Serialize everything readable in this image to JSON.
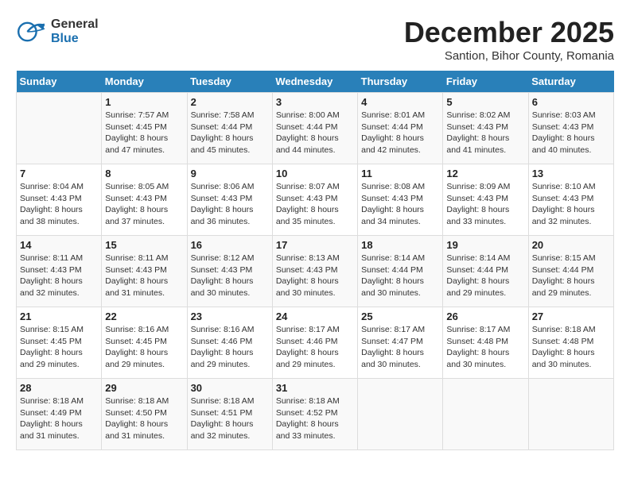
{
  "header": {
    "logo_general": "General",
    "logo_blue": "Blue",
    "month_title": "December 2025",
    "subtitle": "Santion, Bihor County, Romania"
  },
  "days_of_week": [
    "Sunday",
    "Monday",
    "Tuesday",
    "Wednesday",
    "Thursday",
    "Friday",
    "Saturday"
  ],
  "weeks": [
    [
      {
        "day": "",
        "sunrise": "",
        "sunset": "",
        "daylight": ""
      },
      {
        "day": "1",
        "sunrise": "Sunrise: 7:57 AM",
        "sunset": "Sunset: 4:45 PM",
        "daylight": "Daylight: 8 hours and 47 minutes."
      },
      {
        "day": "2",
        "sunrise": "Sunrise: 7:58 AM",
        "sunset": "Sunset: 4:44 PM",
        "daylight": "Daylight: 8 hours and 45 minutes."
      },
      {
        "day": "3",
        "sunrise": "Sunrise: 8:00 AM",
        "sunset": "Sunset: 4:44 PM",
        "daylight": "Daylight: 8 hours and 44 minutes."
      },
      {
        "day": "4",
        "sunrise": "Sunrise: 8:01 AM",
        "sunset": "Sunset: 4:44 PM",
        "daylight": "Daylight: 8 hours and 42 minutes."
      },
      {
        "day": "5",
        "sunrise": "Sunrise: 8:02 AM",
        "sunset": "Sunset: 4:43 PM",
        "daylight": "Daylight: 8 hours and 41 minutes."
      },
      {
        "day": "6",
        "sunrise": "Sunrise: 8:03 AM",
        "sunset": "Sunset: 4:43 PM",
        "daylight": "Daylight: 8 hours and 40 minutes."
      }
    ],
    [
      {
        "day": "7",
        "sunrise": "Sunrise: 8:04 AM",
        "sunset": "Sunset: 4:43 PM",
        "daylight": "Daylight: 8 hours and 38 minutes."
      },
      {
        "day": "8",
        "sunrise": "Sunrise: 8:05 AM",
        "sunset": "Sunset: 4:43 PM",
        "daylight": "Daylight: 8 hours and 37 minutes."
      },
      {
        "day": "9",
        "sunrise": "Sunrise: 8:06 AM",
        "sunset": "Sunset: 4:43 PM",
        "daylight": "Daylight: 8 hours and 36 minutes."
      },
      {
        "day": "10",
        "sunrise": "Sunrise: 8:07 AM",
        "sunset": "Sunset: 4:43 PM",
        "daylight": "Daylight: 8 hours and 35 minutes."
      },
      {
        "day": "11",
        "sunrise": "Sunrise: 8:08 AM",
        "sunset": "Sunset: 4:43 PM",
        "daylight": "Daylight: 8 hours and 34 minutes."
      },
      {
        "day": "12",
        "sunrise": "Sunrise: 8:09 AM",
        "sunset": "Sunset: 4:43 PM",
        "daylight": "Daylight: 8 hours and 33 minutes."
      },
      {
        "day": "13",
        "sunrise": "Sunrise: 8:10 AM",
        "sunset": "Sunset: 4:43 PM",
        "daylight": "Daylight: 8 hours and 32 minutes."
      }
    ],
    [
      {
        "day": "14",
        "sunrise": "Sunrise: 8:11 AM",
        "sunset": "Sunset: 4:43 PM",
        "daylight": "Daylight: 8 hours and 32 minutes."
      },
      {
        "day": "15",
        "sunrise": "Sunrise: 8:11 AM",
        "sunset": "Sunset: 4:43 PM",
        "daylight": "Daylight: 8 hours and 31 minutes."
      },
      {
        "day": "16",
        "sunrise": "Sunrise: 8:12 AM",
        "sunset": "Sunset: 4:43 PM",
        "daylight": "Daylight: 8 hours and 30 minutes."
      },
      {
        "day": "17",
        "sunrise": "Sunrise: 8:13 AM",
        "sunset": "Sunset: 4:43 PM",
        "daylight": "Daylight: 8 hours and 30 minutes."
      },
      {
        "day": "18",
        "sunrise": "Sunrise: 8:14 AM",
        "sunset": "Sunset: 4:44 PM",
        "daylight": "Daylight: 8 hours and 30 minutes."
      },
      {
        "day": "19",
        "sunrise": "Sunrise: 8:14 AM",
        "sunset": "Sunset: 4:44 PM",
        "daylight": "Daylight: 8 hours and 29 minutes."
      },
      {
        "day": "20",
        "sunrise": "Sunrise: 8:15 AM",
        "sunset": "Sunset: 4:44 PM",
        "daylight": "Daylight: 8 hours and 29 minutes."
      }
    ],
    [
      {
        "day": "21",
        "sunrise": "Sunrise: 8:15 AM",
        "sunset": "Sunset: 4:45 PM",
        "daylight": "Daylight: 8 hours and 29 minutes."
      },
      {
        "day": "22",
        "sunrise": "Sunrise: 8:16 AM",
        "sunset": "Sunset: 4:45 PM",
        "daylight": "Daylight: 8 hours and 29 minutes."
      },
      {
        "day": "23",
        "sunrise": "Sunrise: 8:16 AM",
        "sunset": "Sunset: 4:46 PM",
        "daylight": "Daylight: 8 hours and 29 minutes."
      },
      {
        "day": "24",
        "sunrise": "Sunrise: 8:17 AM",
        "sunset": "Sunset: 4:46 PM",
        "daylight": "Daylight: 8 hours and 29 minutes."
      },
      {
        "day": "25",
        "sunrise": "Sunrise: 8:17 AM",
        "sunset": "Sunset: 4:47 PM",
        "daylight": "Daylight: 8 hours and 30 minutes."
      },
      {
        "day": "26",
        "sunrise": "Sunrise: 8:17 AM",
        "sunset": "Sunset: 4:48 PM",
        "daylight": "Daylight: 8 hours and 30 minutes."
      },
      {
        "day": "27",
        "sunrise": "Sunrise: 8:18 AM",
        "sunset": "Sunset: 4:48 PM",
        "daylight": "Daylight: 8 hours and 30 minutes."
      }
    ],
    [
      {
        "day": "28",
        "sunrise": "Sunrise: 8:18 AM",
        "sunset": "Sunset: 4:49 PM",
        "daylight": "Daylight: 8 hours and 31 minutes."
      },
      {
        "day": "29",
        "sunrise": "Sunrise: 8:18 AM",
        "sunset": "Sunset: 4:50 PM",
        "daylight": "Daylight: 8 hours and 31 minutes."
      },
      {
        "day": "30",
        "sunrise": "Sunrise: 8:18 AM",
        "sunset": "Sunset: 4:51 PM",
        "daylight": "Daylight: 8 hours and 32 minutes."
      },
      {
        "day": "31",
        "sunrise": "Sunrise: 8:18 AM",
        "sunset": "Sunset: 4:52 PM",
        "daylight": "Daylight: 8 hours and 33 minutes."
      },
      {
        "day": "",
        "sunrise": "",
        "sunset": "",
        "daylight": ""
      },
      {
        "day": "",
        "sunrise": "",
        "sunset": "",
        "daylight": ""
      },
      {
        "day": "",
        "sunrise": "",
        "sunset": "",
        "daylight": ""
      }
    ]
  ]
}
